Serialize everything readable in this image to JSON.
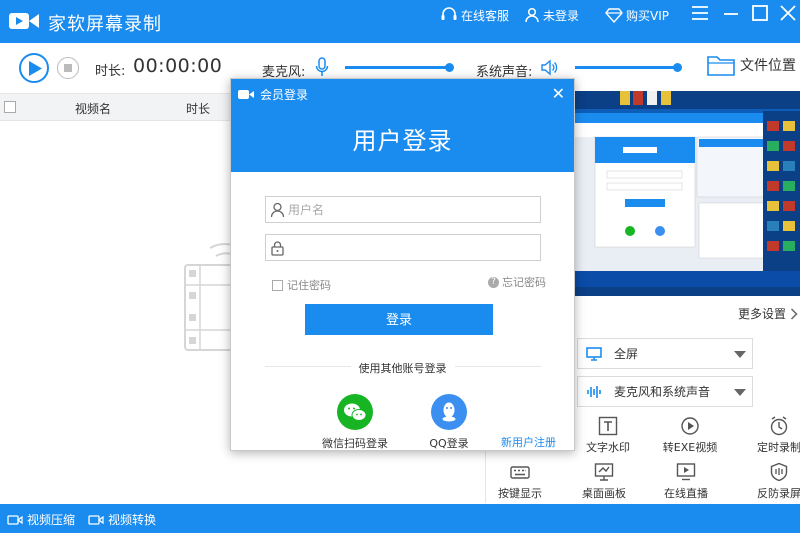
{
  "app": {
    "title": "家软屏幕录制",
    "online_service": "在线客服",
    "login_status": "未登录",
    "buy_vip": "购买VIP"
  },
  "toolbar": {
    "duration_label": "时长:",
    "duration_value": "00:00:00",
    "mic_label": "麦克风:",
    "system_audio_label": "系统声音:",
    "mic_level": 0.95,
    "system_audio_level": 0.96,
    "file_location": "文件位置"
  },
  "list": {
    "columns": [
      "视频名",
      "时长"
    ]
  },
  "settings": {
    "more_settings": "更多设置",
    "capture_area": "全屏",
    "audio_source": "麦克风和系统声音"
  },
  "tools": [
    {
      "label": "文字水印",
      "icon": "text-watermark-icon"
    },
    {
      "label": "转EXE视频",
      "icon": "convert-exe-icon"
    },
    {
      "label": "定时录制",
      "icon": "timer-icon"
    },
    {
      "label": "按键显示",
      "icon": "keyboard-icon"
    },
    {
      "label": "桌面画板",
      "icon": "whiteboard-icon"
    },
    {
      "label": "在线直播",
      "icon": "live-stream-icon"
    },
    {
      "label": "反防录屏",
      "icon": "shield-icon"
    }
  ],
  "bottom": {
    "compress": "视频压缩",
    "convert": "视频转换"
  },
  "modal": {
    "tag": "会员登录",
    "title": "用户登录",
    "username_placeholder": "用户名",
    "password_placeholder": "",
    "remember": "记住密码",
    "forgot": "忘记密码",
    "login": "登录",
    "other_accounts": "使用其他账号登录",
    "wechat": "微信扫码登录",
    "qq": "QQ登录",
    "register": "新用户注册"
  },
  "colors": {
    "accent": "#1a8cf0",
    "wechat": "#17b524",
    "qq": "#3b8ff0"
  }
}
